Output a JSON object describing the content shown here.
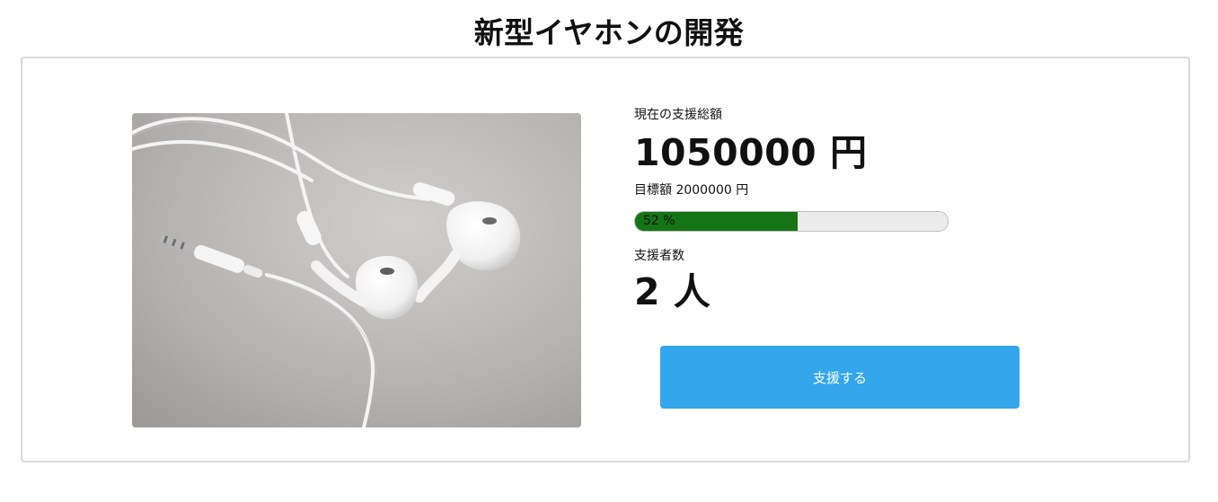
{
  "page": {
    "title": "新型イヤホンの開発"
  },
  "product_image": {
    "alt": "白いイヤホンの写真",
    "icon": "earphones-photo"
  },
  "funding": {
    "current_label": "現在の支援総額",
    "current_amount": "1050000 円",
    "goal_label": "目標額 2000000 円",
    "progress_percent": 52,
    "progress_text": "52 %",
    "supporters_label": "支援者数",
    "supporters_count": "2 人"
  },
  "actions": {
    "support_label": "支援する"
  },
  "colors": {
    "progress_fill": "#157415",
    "progress_track": "#ececec",
    "button": "#33a6ec"
  }
}
